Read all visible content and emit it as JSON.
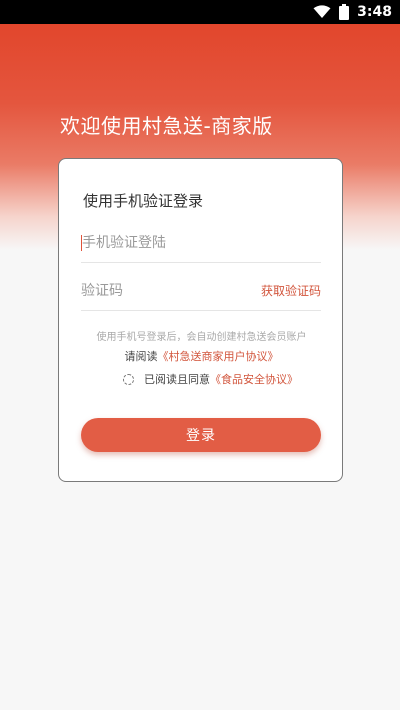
{
  "status_bar": {
    "time": "3:48",
    "wifi_icon": "wifi-icon",
    "battery_icon": "battery-icon"
  },
  "header": {
    "title": "欢迎使用村急送-商家版"
  },
  "login_card": {
    "title": "使用手机验证登录",
    "phone_placeholder": "手机验证登陆",
    "code_placeholder": "验证码",
    "get_code_label": "获取验证码",
    "hint": "使用手机号登录后，会自动创建村急送会员账户",
    "read_prefix": "请阅读",
    "user_agreement_link": "《村急送商家用户协议》",
    "agree_prefix": "已阅读且同意",
    "food_safety_link": "《食品安全协议》",
    "agreed": false,
    "login_label": "登录"
  },
  "colors": {
    "accent": "#e25d45",
    "link": "#d2553c",
    "header_gradient_top": "#e2462c"
  }
}
